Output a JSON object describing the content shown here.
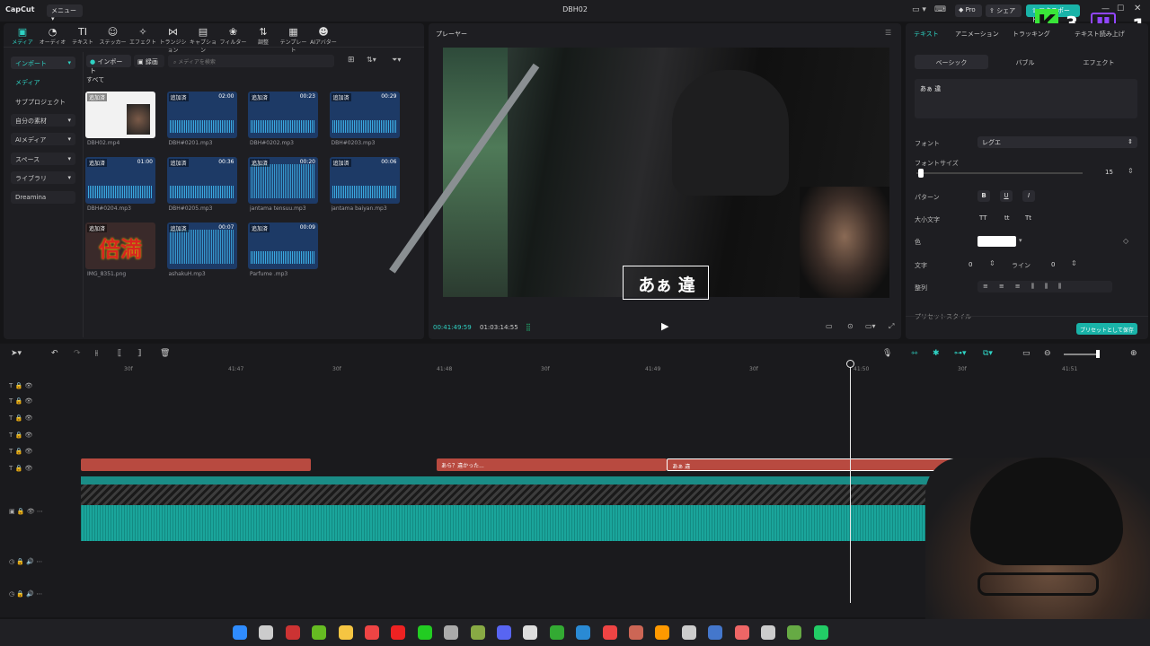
{
  "app": {
    "name": "CapCut",
    "menu_label": "メニュー",
    "project_title": "DBH02"
  },
  "titlebar": {
    "pro_label": "Pro",
    "share_label": "シェア",
    "export_label": "エクスポート",
    "overlay_score": "3",
    "overlay_num": "1"
  },
  "tools": [
    {
      "label": "メディア",
      "icon": "media-icon",
      "glyph": "▣"
    },
    {
      "label": "オーディオ",
      "icon": "audio-icon",
      "glyph": "◔"
    },
    {
      "label": "テキスト",
      "icon": "text-icon",
      "glyph": "TI"
    },
    {
      "label": "ステッカー",
      "icon": "sticker-icon",
      "glyph": "☺"
    },
    {
      "label": "エフェクト",
      "icon": "effect-icon",
      "glyph": "✧"
    },
    {
      "label": "トランジション",
      "icon": "transition-icon",
      "glyph": "⋈"
    },
    {
      "label": "キャプション",
      "icon": "caption-icon",
      "glyph": "▤"
    },
    {
      "label": "フィルター",
      "icon": "filter-icon",
      "glyph": "❀"
    },
    {
      "label": "調整",
      "icon": "adjust-icon",
      "glyph": "⇅"
    },
    {
      "label": "テンプレート",
      "icon": "template-icon",
      "glyph": "▦"
    },
    {
      "label": "AIアバター",
      "icon": "avatar-icon",
      "glyph": "☻"
    }
  ],
  "sidebar": [
    {
      "label": "インポート",
      "has_caret": true
    },
    {
      "label": "メディア"
    },
    {
      "label": "サブプロジェクト"
    },
    {
      "label": "自分の素材",
      "has_caret": true
    },
    {
      "label": "AIメディア",
      "has_caret": true
    },
    {
      "label": "スペース",
      "has_caret": true
    },
    {
      "label": "ライブラリ",
      "has_caret": true
    },
    {
      "label": "Dreamina"
    }
  ],
  "media": {
    "import_label": "インポート",
    "record_label": "録画",
    "search_placeholder": "メディアを検索",
    "filter_all": "すべて",
    "items": [
      {
        "tag": "追加済",
        "duration": "",
        "name": "DBH02.mp4",
        "kind": "video"
      },
      {
        "tag": "追加済",
        "duration": "02:00",
        "name": "DBH#0201.mp3",
        "kind": "audio"
      },
      {
        "tag": "追加済",
        "duration": "00:23",
        "name": "DBH#0202.mp3",
        "kind": "audio"
      },
      {
        "tag": "追加済",
        "duration": "00:29",
        "name": "DBH#0203.mp3",
        "kind": "audio"
      },
      {
        "tag": "追加済",
        "duration": "01:00",
        "name": "DBH#0204.mp3",
        "kind": "audio"
      },
      {
        "tag": "追加済",
        "duration": "00:36",
        "name": "DBH#0205.mp3",
        "kind": "audio"
      },
      {
        "tag": "追加済",
        "duration": "00:20",
        "name": "jantama tensuu.mp3",
        "kind": "audio-tall"
      },
      {
        "tag": "追加済",
        "duration": "00:06",
        "name": "jantama baiyan.mp3",
        "kind": "audio"
      },
      {
        "tag": "追加済",
        "duration": "",
        "name": "IMG_8351.png",
        "kind": "image",
        "image_text": "倍満"
      },
      {
        "tag": "追加済",
        "duration": "00:07",
        "name": "ashakuH.mp3",
        "kind": "audio-tall"
      },
      {
        "tag": "追加済",
        "duration": "00:09",
        "name": "Parfume .mp3",
        "kind": "audio"
      }
    ]
  },
  "player": {
    "title": "プレーヤー",
    "current_time": "00:41:49:59",
    "total_time": "01:03:14:55",
    "caption_text": "あぁ 違"
  },
  "props": {
    "tabs": [
      "テキスト",
      "アニメーション",
      "トラッキング",
      "テキスト読み上げ"
    ],
    "subtabs": [
      "ベーシック",
      "バブル",
      "エフェクト"
    ],
    "text_value": "あぁ 違",
    "font_label": "フォント",
    "font_value": "レグエ",
    "font_size_label": "フォントサイズ",
    "font_size_value": "15",
    "pattern_label": "パターン",
    "case_label": "大小文字",
    "color_label": "色",
    "char_label": "文字",
    "char_value": "0",
    "line_label": "ライン",
    "line_value": "0",
    "align_label": "整列",
    "preset_label": "プリセットスタイル",
    "save_preset_label": "プリセットとして保存",
    "color_value": "#ffffff"
  },
  "timeline": {
    "ruler_labels": [
      "30f",
      "41:47",
      "30f",
      "41:48",
      "30f",
      "41:49",
      "30f",
      "41:50",
      "30f",
      "41:51"
    ],
    "clips": [
      {
        "label": "",
        "start_sec": 0.0,
        "end_sec": 1.1
      },
      {
        "label": "あら？違かった...",
        "start_sec": 1.7,
        "end_sec": 2.8
      },
      {
        "label": "あぁ 違",
        "start_sec": 2.8,
        "end_sec": 4.4
      }
    ]
  },
  "colors": {
    "accent": "#2fd3c4",
    "clip_red": "#b84a40",
    "track_teal": "#1a8c86"
  }
}
